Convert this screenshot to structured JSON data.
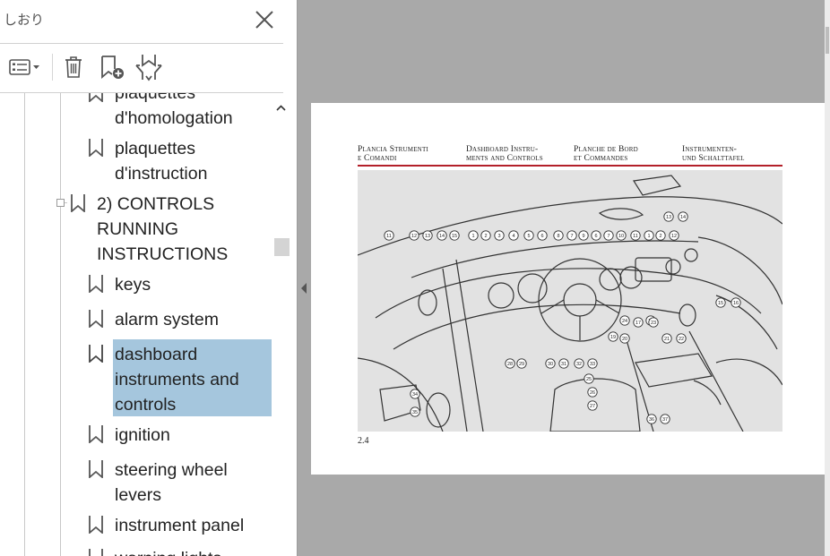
{
  "sidebar": {
    "title": "しおり",
    "toolbar": {
      "options_icon": "list-options-icon",
      "delete_icon": "trash-icon",
      "new_bookmark_icon": "bookmark-add-icon",
      "expand_icon": "expand-bookmark-icon"
    },
    "bookmarks": [
      {
        "lines": [
          "plaquettes",
          "d'homologation"
        ],
        "level": 2
      },
      {
        "lines": [
          "plaquettes",
          "d'instruction"
        ],
        "level": 2
      },
      {
        "lines": [
          "2) CONTROLS",
          "RUNNING",
          "INSTRUCTIONS"
        ],
        "level": 1,
        "expanded": true
      },
      {
        "lines": [
          "keys"
        ],
        "level": 2
      },
      {
        "lines": [
          "alarm system"
        ],
        "level": 2
      },
      {
        "lines": [
          "dashboard",
          "instruments and",
          "controls"
        ],
        "level": 2,
        "selected": true
      },
      {
        "lines": [
          "ignition"
        ],
        "level": 2
      },
      {
        "lines": [
          "steering wheel",
          "levers"
        ],
        "level": 2
      },
      {
        "lines": [
          "instrument panel"
        ],
        "level": 2
      },
      {
        "lines": [
          "warning lights"
        ],
        "level": 2
      }
    ],
    "selected_color": "#a5c6dd"
  },
  "document": {
    "headers": [
      {
        "l1": "Plancia Strumenti",
        "l2": "e Comandi"
      },
      {
        "l1": "Dashboard Instru-",
        "l2": "ments and Controls"
      },
      {
        "l1": "Planche de Bord",
        "l2": "et Commandes"
      },
      {
        "l1": "Instrumenten-",
        "l2": "und Schalttafel"
      }
    ],
    "accent_color": "#b3202a",
    "page_number": "2.4",
    "figure_callouts": [
      "11",
      "12",
      "13",
      "14",
      "15",
      "1",
      "2",
      "3",
      "4",
      "5",
      "6",
      "8",
      "7",
      "9",
      "6",
      "7",
      "10",
      "11",
      "1",
      "2",
      "12",
      "13",
      "14",
      "15",
      "16",
      "17",
      "18",
      "19",
      "20",
      "21",
      "22",
      "23",
      "24",
      "25",
      "26",
      "27",
      "28",
      "29",
      "30",
      "31",
      "32",
      "33",
      "34",
      "35",
      "36",
      "37"
    ]
  }
}
